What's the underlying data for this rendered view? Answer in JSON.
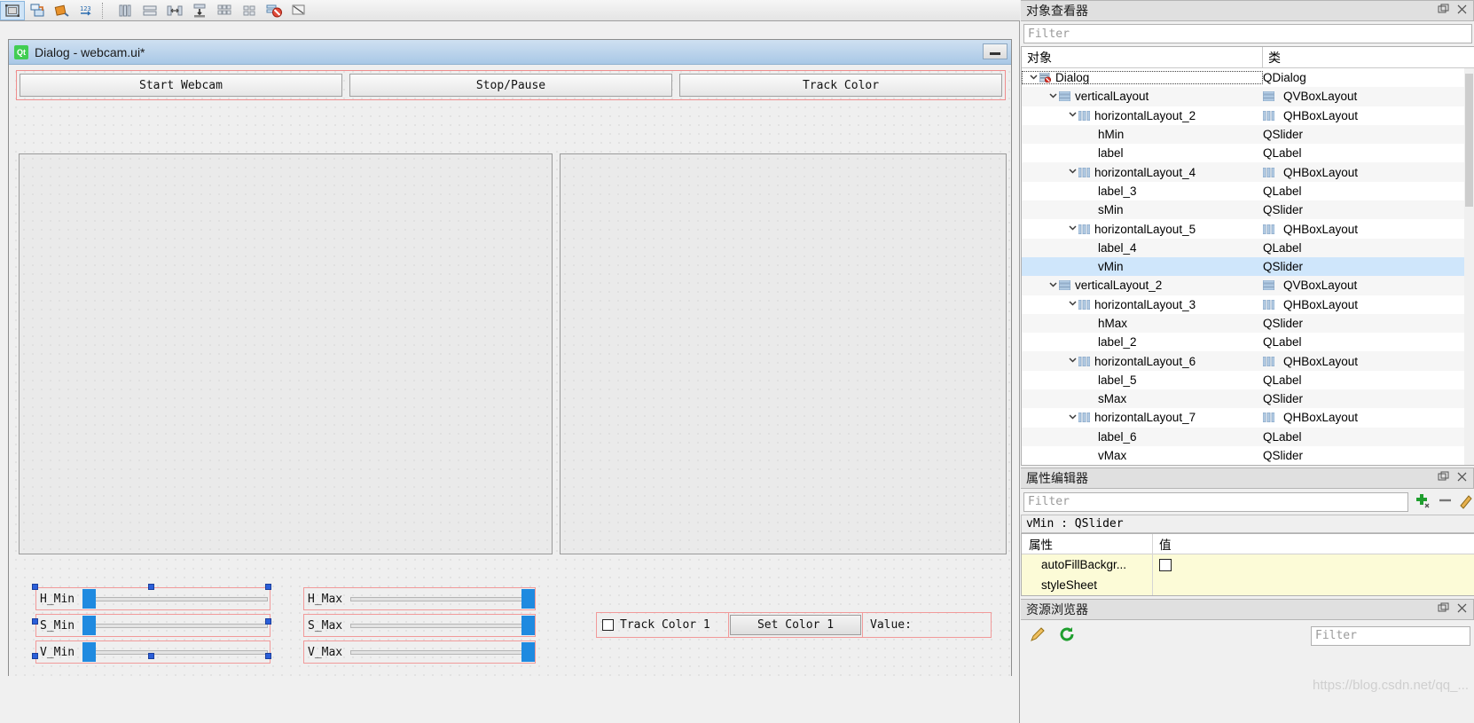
{
  "toolbar": {
    "items": [
      {
        "name": "edit-widgets-icon",
        "glyph": "widget"
      },
      {
        "name": "edit-signals-slots-icon",
        "glyph": "signals"
      },
      {
        "name": "edit-buddies-icon",
        "glyph": "buddy"
      },
      {
        "name": "edit-tab-order-icon",
        "glyph": "taborder"
      },
      {
        "name": "layout-horizontally-icon",
        "glyph": "lay-h"
      },
      {
        "name": "layout-vertically-icon",
        "glyph": "lay-v"
      },
      {
        "name": "layout-in-splitter-horizontal-icon",
        "glyph": "split-h"
      },
      {
        "name": "layout-in-splitter-vertical-icon",
        "glyph": "split-v"
      },
      {
        "name": "layout-in-grid-icon",
        "glyph": "grid"
      },
      {
        "name": "layout-in-form-icon",
        "glyph": "form"
      },
      {
        "name": "break-layout-icon",
        "glyph": "break"
      },
      {
        "name": "adjust-size-icon",
        "glyph": "adjust"
      }
    ]
  },
  "form": {
    "title": "Dialog - webcam.ui*",
    "logo_text": "Qt",
    "buttons": [
      {
        "label": "Start Webcam"
      },
      {
        "label": "Stop/Pause"
      },
      {
        "label": "Track Color"
      }
    ],
    "sliders_min": [
      {
        "label": "H_Min"
      },
      {
        "label": "S_Min"
      },
      {
        "label": "V_Min"
      }
    ],
    "sliders_max": [
      {
        "label": "H_Max"
      },
      {
        "label": "S_Max"
      },
      {
        "label": "V_Max"
      }
    ],
    "track_color": {
      "checkbox_label": "Track Color 1",
      "set_button": "Set Color 1",
      "value_label": "Value:"
    }
  },
  "object_inspector": {
    "title": "对象查看器",
    "filter_placeholder": "Filter",
    "columns": {
      "object": "对象",
      "class": "类"
    },
    "rows": [
      {
        "name": "Dialog",
        "class": "QDialog",
        "depth": 0,
        "chevron": "v",
        "icon": "dialog",
        "class_icon": false,
        "selected": false,
        "dotted": true
      },
      {
        "name": "verticalLayout",
        "class": "QVBoxLayout",
        "depth": 1,
        "chevron": "v",
        "icon": "vbox",
        "class_icon": true,
        "selected": false,
        "dotted": false
      },
      {
        "name": "horizontalLayout_2",
        "class": "QHBoxLayout",
        "depth": 2,
        "chevron": "v",
        "icon": "hbox",
        "class_icon": true,
        "selected": false,
        "dotted": false
      },
      {
        "name": "hMin",
        "class": "QSlider",
        "depth": 3,
        "chevron": "",
        "icon": "",
        "class_icon": false,
        "selected": false,
        "dotted": false
      },
      {
        "name": "label",
        "class": "QLabel",
        "depth": 3,
        "chevron": "",
        "icon": "",
        "class_icon": false,
        "selected": false,
        "dotted": false
      },
      {
        "name": "horizontalLayout_4",
        "class": "QHBoxLayout",
        "depth": 2,
        "chevron": "v",
        "icon": "hbox",
        "class_icon": true,
        "selected": false,
        "dotted": false
      },
      {
        "name": "label_3",
        "class": "QLabel",
        "depth": 3,
        "chevron": "",
        "icon": "",
        "class_icon": false,
        "selected": false,
        "dotted": false
      },
      {
        "name": "sMin",
        "class": "QSlider",
        "depth": 3,
        "chevron": "",
        "icon": "",
        "class_icon": false,
        "selected": false,
        "dotted": false
      },
      {
        "name": "horizontalLayout_5",
        "class": "QHBoxLayout",
        "depth": 2,
        "chevron": "v",
        "icon": "hbox",
        "class_icon": true,
        "selected": false,
        "dotted": false
      },
      {
        "name": "label_4",
        "class": "QLabel",
        "depth": 3,
        "chevron": "",
        "icon": "",
        "class_icon": false,
        "selected": false,
        "dotted": false
      },
      {
        "name": "vMin",
        "class": "QSlider",
        "depth": 3,
        "chevron": "",
        "icon": "",
        "class_icon": false,
        "selected": true,
        "dotted": false
      },
      {
        "name": "verticalLayout_2",
        "class": "QVBoxLayout",
        "depth": 1,
        "chevron": "v",
        "icon": "vbox",
        "class_icon": true,
        "selected": false,
        "dotted": false
      },
      {
        "name": "horizontalLayout_3",
        "class": "QHBoxLayout",
        "depth": 2,
        "chevron": "v",
        "icon": "hbox",
        "class_icon": true,
        "selected": false,
        "dotted": false
      },
      {
        "name": "hMax",
        "class": "QSlider",
        "depth": 3,
        "chevron": "",
        "icon": "",
        "class_icon": false,
        "selected": false,
        "dotted": false
      },
      {
        "name": "label_2",
        "class": "QLabel",
        "depth": 3,
        "chevron": "",
        "icon": "",
        "class_icon": false,
        "selected": false,
        "dotted": false
      },
      {
        "name": "horizontalLayout_6",
        "class": "QHBoxLayout",
        "depth": 2,
        "chevron": "v",
        "icon": "hbox",
        "class_icon": true,
        "selected": false,
        "dotted": false
      },
      {
        "name": "label_5",
        "class": "QLabel",
        "depth": 3,
        "chevron": "",
        "icon": "",
        "class_icon": false,
        "selected": false,
        "dotted": false
      },
      {
        "name": "sMax",
        "class": "QSlider",
        "depth": 3,
        "chevron": "",
        "icon": "",
        "class_icon": false,
        "selected": false,
        "dotted": false
      },
      {
        "name": "horizontalLayout_7",
        "class": "QHBoxLayout",
        "depth": 2,
        "chevron": "v",
        "icon": "hbox",
        "class_icon": true,
        "selected": false,
        "dotted": false
      },
      {
        "name": "label_6",
        "class": "QLabel",
        "depth": 3,
        "chevron": "",
        "icon": "",
        "class_icon": false,
        "selected": false,
        "dotted": false
      },
      {
        "name": "vMax",
        "class": "QSlider",
        "depth": 3,
        "chevron": "",
        "icon": "",
        "class_icon": false,
        "selected": false,
        "dotted": false
      }
    ]
  },
  "property_editor": {
    "title": "属性编辑器",
    "filter_placeholder": "Filter",
    "object_header": "vMin : QSlider",
    "columns": {
      "property": "属性",
      "value": "值"
    },
    "rows": [
      {
        "name": "autoFillBackgr...",
        "value": "",
        "type": "checkbox",
        "indent": true
      },
      {
        "name": "styleSheet",
        "value": "",
        "type": "text",
        "indent": true
      }
    ]
  },
  "resource_browser": {
    "title": "资源浏览器",
    "filter_placeholder": "Filter",
    "icons": [
      "pencil-icon",
      "refresh-icon"
    ]
  },
  "watermark": "https://blog.csdn.net/qq_..."
}
